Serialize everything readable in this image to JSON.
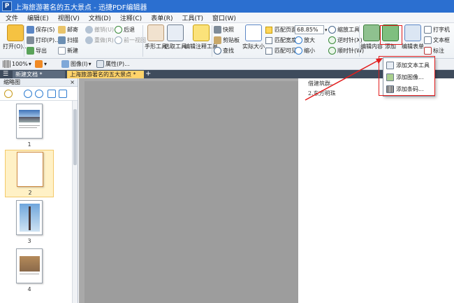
{
  "window": {
    "title": "上海旅游著名的五大景点 - 迅捷PDF编辑器",
    "logo_letter": "P"
  },
  "menubar": {
    "items": [
      "文件",
      "编辑(E)",
      "视图(V)",
      "文档(D)",
      "注释(C)",
      "表单(R)",
      "工具(T)",
      "窗口(W)"
    ]
  },
  "ribbon": {
    "open": "打开(O)...",
    "save": "保存(S)",
    "print": "打印(P)...",
    "export": "导出",
    "mail": "邮寄",
    "scan": "扫描",
    "new": "新建",
    "undo": "撤销(U)",
    "redo": "重做(R)",
    "back": "后退",
    "forward": "前一视图",
    "hand_tool": "手形工具",
    "select_tool": "选取工具",
    "note_tool": "编辑注释工具",
    "snapshot": "快照",
    "clipboard": "剪贴板",
    "find": "查找",
    "actual_size": "实际大小",
    "fit_page": "匹配页面",
    "fit_width": "匹配宽度",
    "fit_visible": "匹配可见",
    "zoom_value": "68.85%",
    "zoom_tool": "缩放工具",
    "zoom_in": "放大",
    "zoom_out": "缩小",
    "rotate_ccw": "逆时针(X)",
    "rotate_cw": "顺时针(W)",
    "edit_content": "编辑内容",
    "add": "添加",
    "edit_form": "编辑表单",
    "typewriter": "打字机",
    "textbox": "文本框",
    "label": "标注"
  },
  "toolbar2": {
    "zoom": "100%",
    "image": "图像(I)",
    "properties": "属性(P)..."
  },
  "tabs": [
    {
      "label": "新建文档 *"
    },
    {
      "label": "上海旅游著名的五大景点 *"
    }
  ],
  "sidebar": {
    "title": "缩略图",
    "pages": [
      "1",
      "2",
      "3",
      "4"
    ]
  },
  "document": {
    "line1": "借建筑群。",
    "line2": "2.东方明珠"
  },
  "dropdown": {
    "items": [
      "添加文本工具",
      "添加图像...",
      "添加条码..."
    ]
  },
  "colors": {
    "title_bar": "#2b6fd0",
    "annotation": "#e21d1d",
    "selected_tab": "#ffd36a"
  }
}
